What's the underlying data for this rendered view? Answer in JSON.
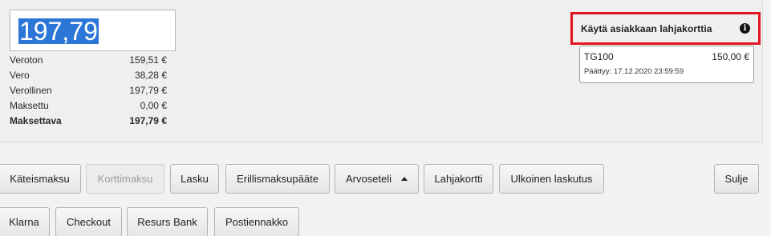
{
  "payment": {
    "amount_input": "197,79",
    "totals": [
      {
        "label": "Veroton",
        "value": "159,51 €"
      },
      {
        "label": "Vero",
        "value": "38,28 €"
      },
      {
        "label": "Verollinen",
        "value": "197,79 €"
      },
      {
        "label": "Maksettu",
        "value": "0,00 €"
      },
      {
        "label": "Maksettava",
        "value": "197,79 €"
      }
    ]
  },
  "gift_card": {
    "title": "Käytä asiakkaan lahjakorttia",
    "info_icon": "info-icon",
    "card": {
      "code": "TG100",
      "amount": "150,00 €",
      "expiry": "Päättyy: 17.12.2020 23:59:59"
    }
  },
  "buttons": {
    "cash": "Käteismaksu",
    "card": "Korttimaksu",
    "invoice": "Lasku",
    "separate_terminal": "Erillismaksupääte",
    "voucher": "Arvoseteli",
    "gift_card": "Lahjakortti",
    "external_invoice": "Ulkoinen laskutus",
    "close": "Sulje",
    "klarna": "Klarna",
    "checkout": "Checkout",
    "resurs": "Resurs Bank",
    "postal": "Postiennakko"
  }
}
